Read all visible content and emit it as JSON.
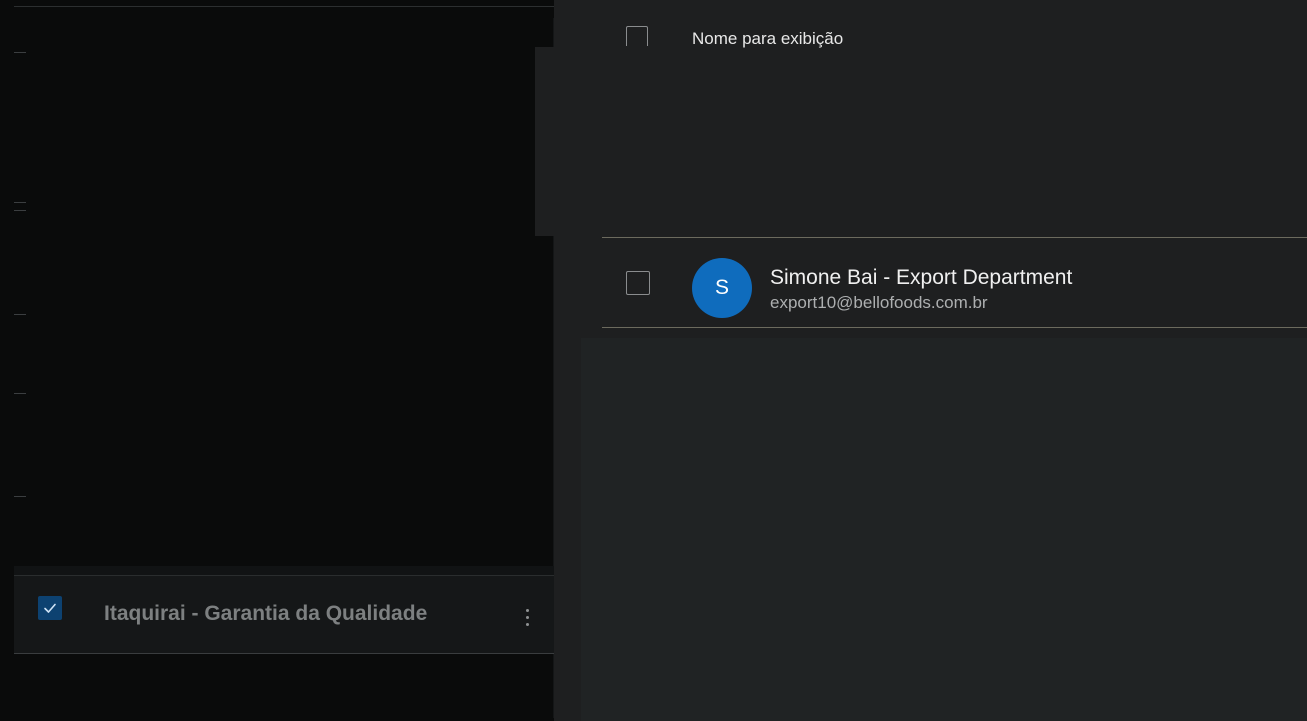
{
  "background_list": {
    "selected_row": {
      "label": "Itaquirai - Garantia da Qualidade",
      "checked": true,
      "checkbox_color": "#0d4271"
    }
  },
  "picker_panel": {
    "header": {
      "column_label": "Nome para exibição"
    },
    "results": [
      {
        "avatar_initial": "S",
        "avatar_color": "#0f6cbd",
        "name": "Simone Bai - Export Department",
        "email": "export10@bellofoods.com.br",
        "checked": false
      }
    ]
  }
}
